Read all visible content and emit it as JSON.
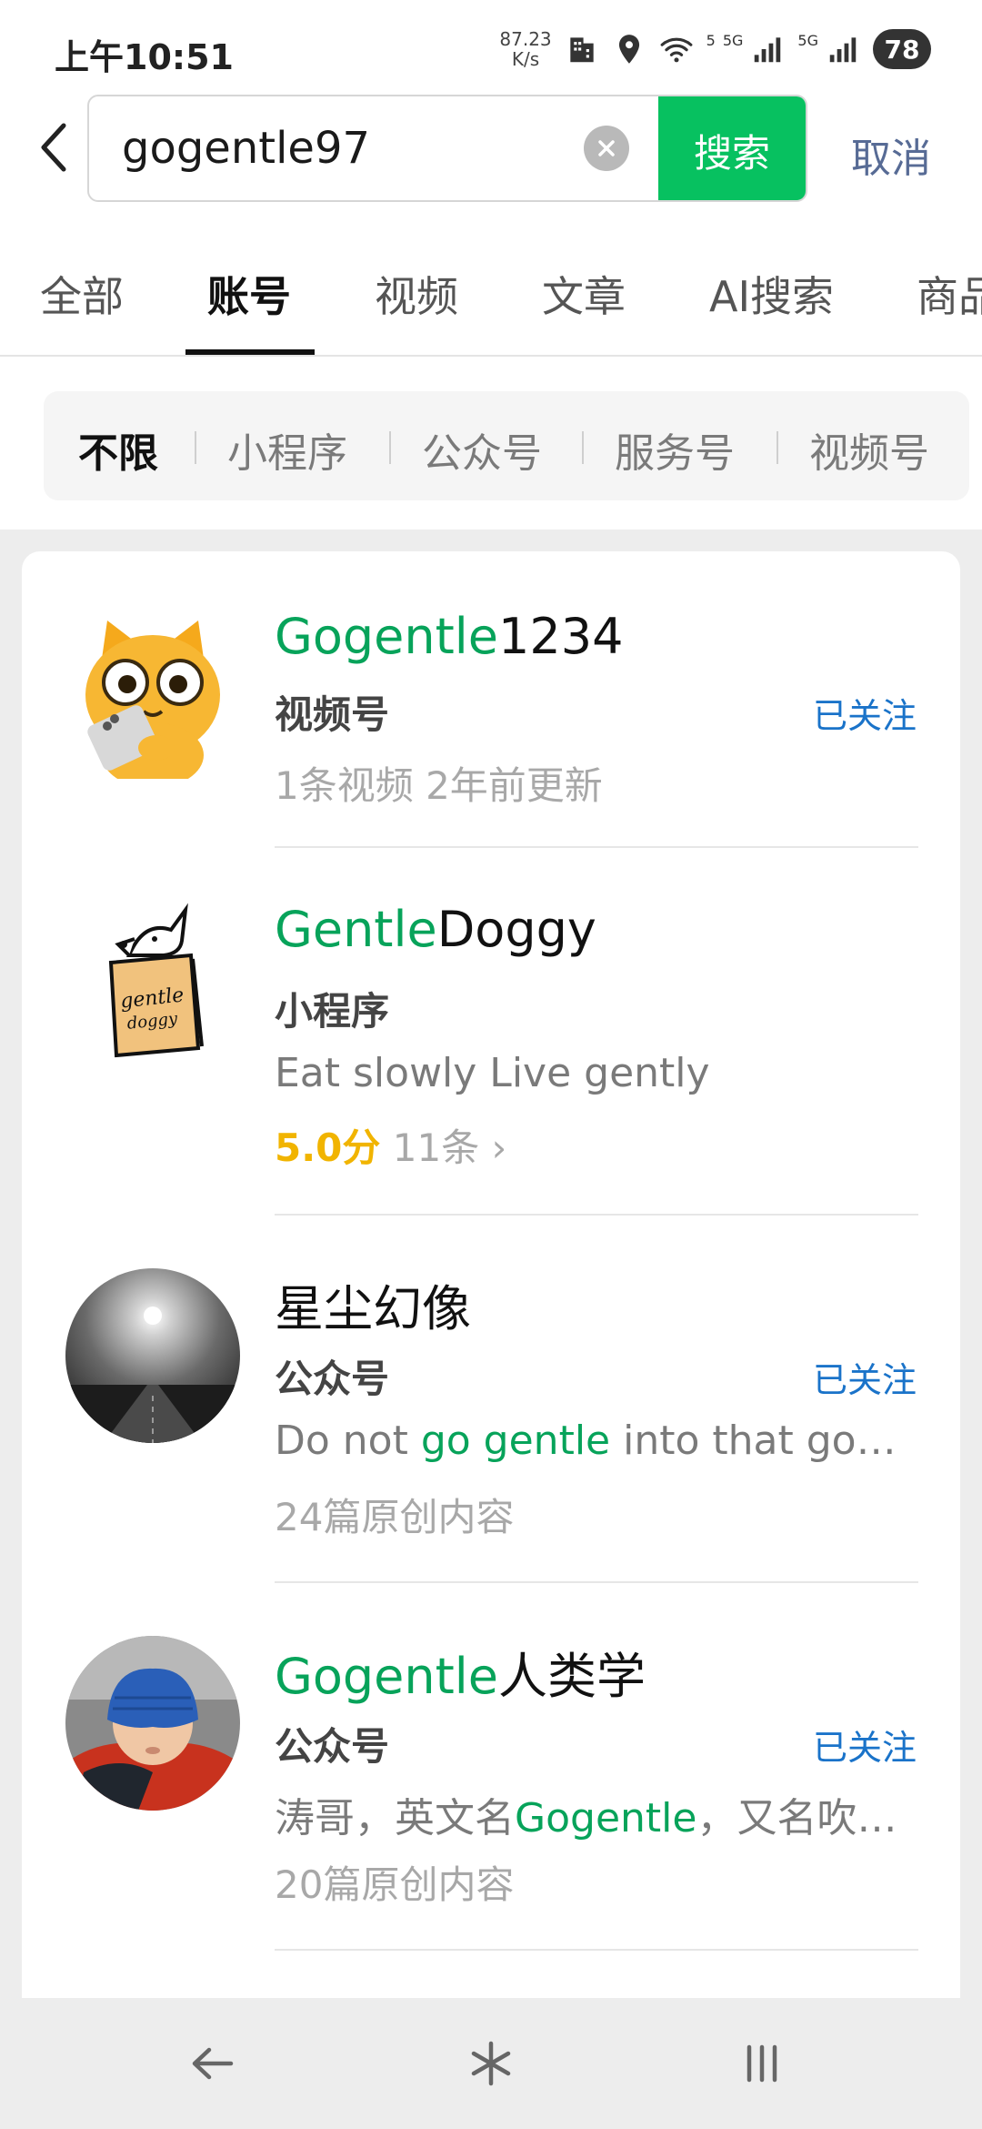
{
  "status_bar": {
    "time": "上午10:51",
    "net_speed_value": "87.23",
    "net_speed_unit": "K/s",
    "wifi_label": "5",
    "signal1_label": "5G",
    "signal2_label": "5G",
    "battery": "78"
  },
  "search": {
    "query": "gogentle97",
    "button_label": "搜索",
    "cancel_label": "取消"
  },
  "tabs": {
    "active_index": 1,
    "items": [
      "全部",
      "账号",
      "视频",
      "文章",
      "AI搜索",
      "商品"
    ]
  },
  "filters": {
    "active_index": 0,
    "items": [
      "不限",
      "小程序",
      "公众号",
      "服务号",
      "视频号"
    ]
  },
  "results": [
    {
      "name_highlight": "Gogentle",
      "name_rest": "1234",
      "type": "视频号",
      "meta": "1条视频  2年前更新",
      "followed": "已关注"
    },
    {
      "name_highlight": "Gentle",
      "name_rest": "Doggy",
      "type": "小程序",
      "desc": "Eat slowly Live gently",
      "rating": "5.0分",
      "rating_count": "11条 ›"
    },
    {
      "name_plain": "星尘幻像",
      "type": "公众号",
      "followed": "已关注",
      "desc_pre": "Do not ",
      "desc_highlight": "go gentle",
      "desc_post": " into that good …",
      "meta": "24篇原创内容"
    },
    {
      "name_highlight": "Gogentle",
      "name_rest": "人类学",
      "type": "公众号",
      "followed": "已关注",
      "desc_pre": "涛哥，英文名",
      "desc_highlight": "Gogentle",
      "desc_post": "，又名吹…",
      "meta": "20篇原创内容"
    }
  ],
  "colors": {
    "accent_green": "#07c160",
    "highlight_green": "#07a35a",
    "link_blue": "#1a73c9",
    "cancel_blue": "#576b95",
    "rating_yellow": "#f1b400"
  },
  "icons": {
    "back": "chevron-left-icon",
    "clear": "clear-icon",
    "nav_back": "arrow-left-icon",
    "nav_home": "asterisk-icon",
    "nav_recents": "recents-icon"
  }
}
